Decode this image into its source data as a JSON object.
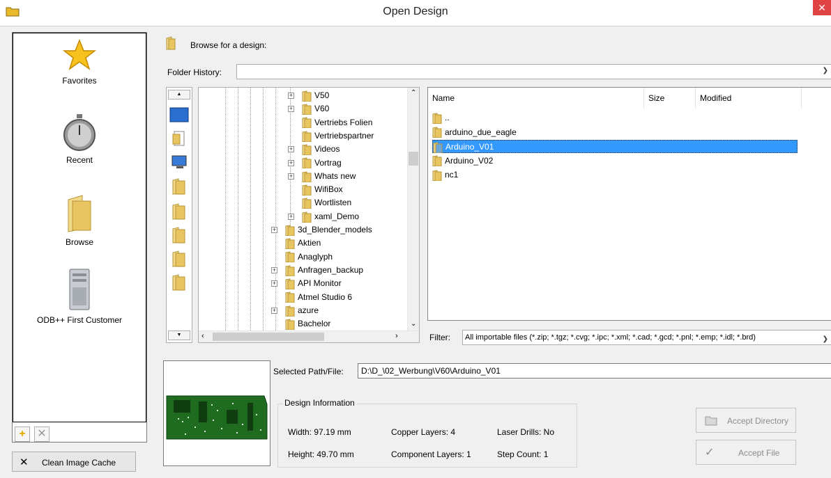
{
  "window": {
    "title": "Open Design",
    "close_glyph": "✕"
  },
  "nav": {
    "items": [
      {
        "label": "Favorites",
        "icon": "star-icon"
      },
      {
        "label": "Recent",
        "icon": "stopwatch-icon"
      },
      {
        "label": "Browse",
        "icon": "folder-icon"
      },
      {
        "label": "ODB++ First Customer",
        "icon": "computer-tower-icon"
      }
    ],
    "add_glyph": "+",
    "remove_glyph": "✕",
    "clean_cache_label": "Clean Image Cache",
    "clean_cache_glyph": "✕"
  },
  "browse": {
    "header": "Browse for a design:",
    "folder_history_label": "Folder History:",
    "folder_history_value": ""
  },
  "tree": {
    "items": [
      {
        "label": "V50",
        "level": 1,
        "expander": true
      },
      {
        "label": "V60",
        "level": 1,
        "expander": true,
        "open": true
      },
      {
        "label": "Vertriebs Folien",
        "level": 1,
        "expander": false
      },
      {
        "label": "Vertriebspartner",
        "level": 1,
        "expander": false
      },
      {
        "label": "Videos",
        "level": 1,
        "expander": true
      },
      {
        "label": "Vortrag",
        "level": 1,
        "expander": true
      },
      {
        "label": "Whats new",
        "level": 1,
        "expander": true
      },
      {
        "label": "WifiBox",
        "level": 1,
        "expander": false
      },
      {
        "label": "Wortlisten",
        "level": 1,
        "expander": false
      },
      {
        "label": "xaml_Demo",
        "level": 1,
        "expander": true
      },
      {
        "label": "3d_Blender_models",
        "level": 0,
        "expander": true
      },
      {
        "label": "Aktien",
        "level": 0,
        "expander": false
      },
      {
        "label": "Anaglyph",
        "level": 0,
        "expander": false
      },
      {
        "label": "Anfragen_backup",
        "level": 0,
        "expander": true
      },
      {
        "label": "API Monitor",
        "level": 0,
        "expander": true
      },
      {
        "label": "Atmel Studio 6",
        "level": 0,
        "expander": false
      },
      {
        "label": "azure",
        "level": 0,
        "expander": true
      },
      {
        "label": "Bachelor",
        "level": 0,
        "expander": false
      }
    ]
  },
  "files": {
    "columns": [
      "Name",
      "Size",
      "Modified"
    ],
    "rows": [
      {
        "name": "..",
        "selected": false
      },
      {
        "name": "arduino_due_eagle",
        "selected": false
      },
      {
        "name": "Arduino_V01",
        "selected": true
      },
      {
        "name": "Arduino_V02",
        "selected": false
      },
      {
        "name": "nc1",
        "selected": false
      }
    ]
  },
  "filter": {
    "label": "Filter:",
    "value": "All importable files (*.zip; *.tgz; *.cvg; *.ipc; *.xml; *.cad; *.gcd; *.pnl; *.emp; *.idl; *.brd)"
  },
  "selection": {
    "label": "Selected Path/File:",
    "value": "D:\\D_\\02_Werbung\\V60\\Arduino_V01"
  },
  "design_info": {
    "title": "Design Information",
    "width": "Width: 97.19 mm",
    "height": "Height: 49.70 mm",
    "copper_layers": "Copper Layers: 4",
    "component_layers": "Component Layers: 1",
    "laser_drills": "Laser Drills: No",
    "step_count": "Step Count: 1"
  },
  "actions": {
    "accept_directory": "Accept Directory",
    "accept_file": "Accept File"
  },
  "colors": {
    "selection": "#3399ff",
    "folder": "#e8b92a",
    "pcb_green": "#1f6b1f",
    "close_red": "#e04343"
  }
}
